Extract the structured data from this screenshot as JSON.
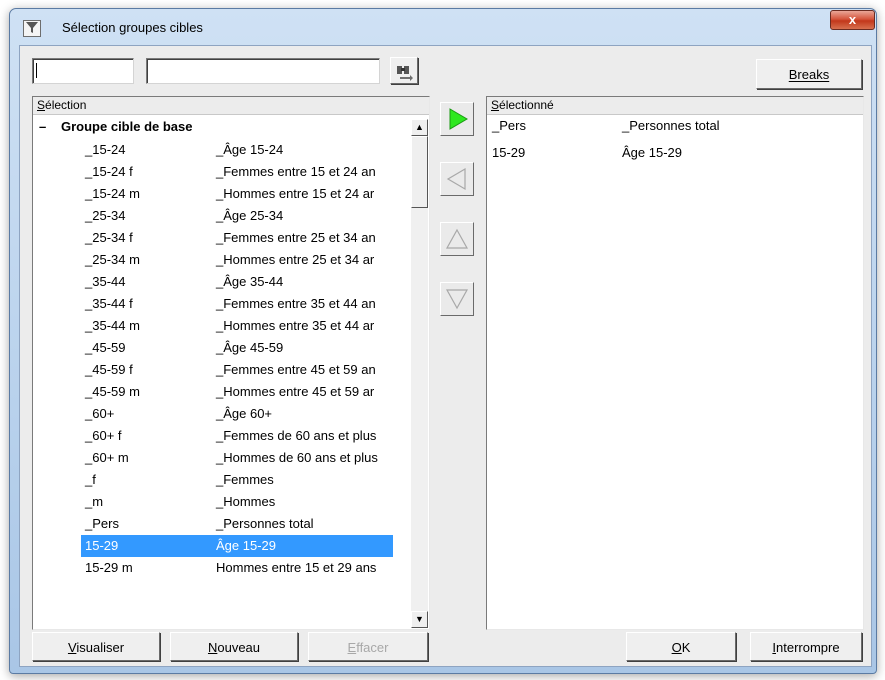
{
  "window": {
    "title": "Sélection groupes cibles",
    "close_glyph": "x"
  },
  "toolbar": {
    "search_value_1": "",
    "search_value_2": "",
    "breaks_label": "Breaks"
  },
  "left_panel": {
    "header": "Sélection",
    "group_toggle": "–",
    "group_label": "Groupe cible de base",
    "items": [
      {
        "code": "_15-24",
        "desc": "_Âge 15-24"
      },
      {
        "code": "_15-24 f",
        "desc": "_Femmes entre 15 et 24 an"
      },
      {
        "code": "_15-24 m",
        "desc": "_Hommes entre 15 et 24 ar"
      },
      {
        "code": "_25-34",
        "desc": "_Âge 25-34"
      },
      {
        "code": "_25-34 f",
        "desc": "_Femmes entre 25 et 34 an"
      },
      {
        "code": "_25-34 m",
        "desc": "_Hommes entre 25 et 34 ar"
      },
      {
        "code": "_35-44",
        "desc": "_Âge 35-44"
      },
      {
        "code": "_35-44 f",
        "desc": "_Femmes entre 35 et 44 an"
      },
      {
        "code": "_35-44 m",
        "desc": "_Hommes entre 35 et 44 ar"
      },
      {
        "code": "_45-59",
        "desc": "_Âge 45-59"
      },
      {
        "code": "_45-59 f",
        "desc": "_Femmes entre 45 et 59 an"
      },
      {
        "code": "_45-59 m",
        "desc": "_Hommes entre 45 et 59 ar"
      },
      {
        "code": "_60+",
        "desc": "_Âge 60+"
      },
      {
        "code": "_60+ f",
        "desc": "_Femmes de 60 ans et plus"
      },
      {
        "code": "_60+ m",
        "desc": "_Hommes de 60 ans et plus"
      },
      {
        "code": "_f",
        "desc": "_Femmes"
      },
      {
        "code": "_m",
        "desc": "_Hommes"
      },
      {
        "code": "_Pers",
        "desc": "_Personnes total"
      },
      {
        "code": "15-29",
        "desc": "Âge 15-29"
      },
      {
        "code": "15-29 m",
        "desc": "Hommes entre 15 et 29 ans"
      }
    ],
    "selected_index": 18
  },
  "right_panel": {
    "header": "Sélectionné",
    "items": [
      {
        "code": "_Pers",
        "desc": "_Personnes total"
      },
      {
        "code": "15-29",
        "desc": "Âge 15-29"
      }
    ]
  },
  "buttons": {
    "visualiser": "Visualiser",
    "nouveau": "Nouveau",
    "effacer": "Effacer",
    "ok": "OK",
    "interrompre": "Interrompre"
  },
  "colors": {
    "selection": "#3399ff",
    "add_arrow": "#2ee81f"
  }
}
